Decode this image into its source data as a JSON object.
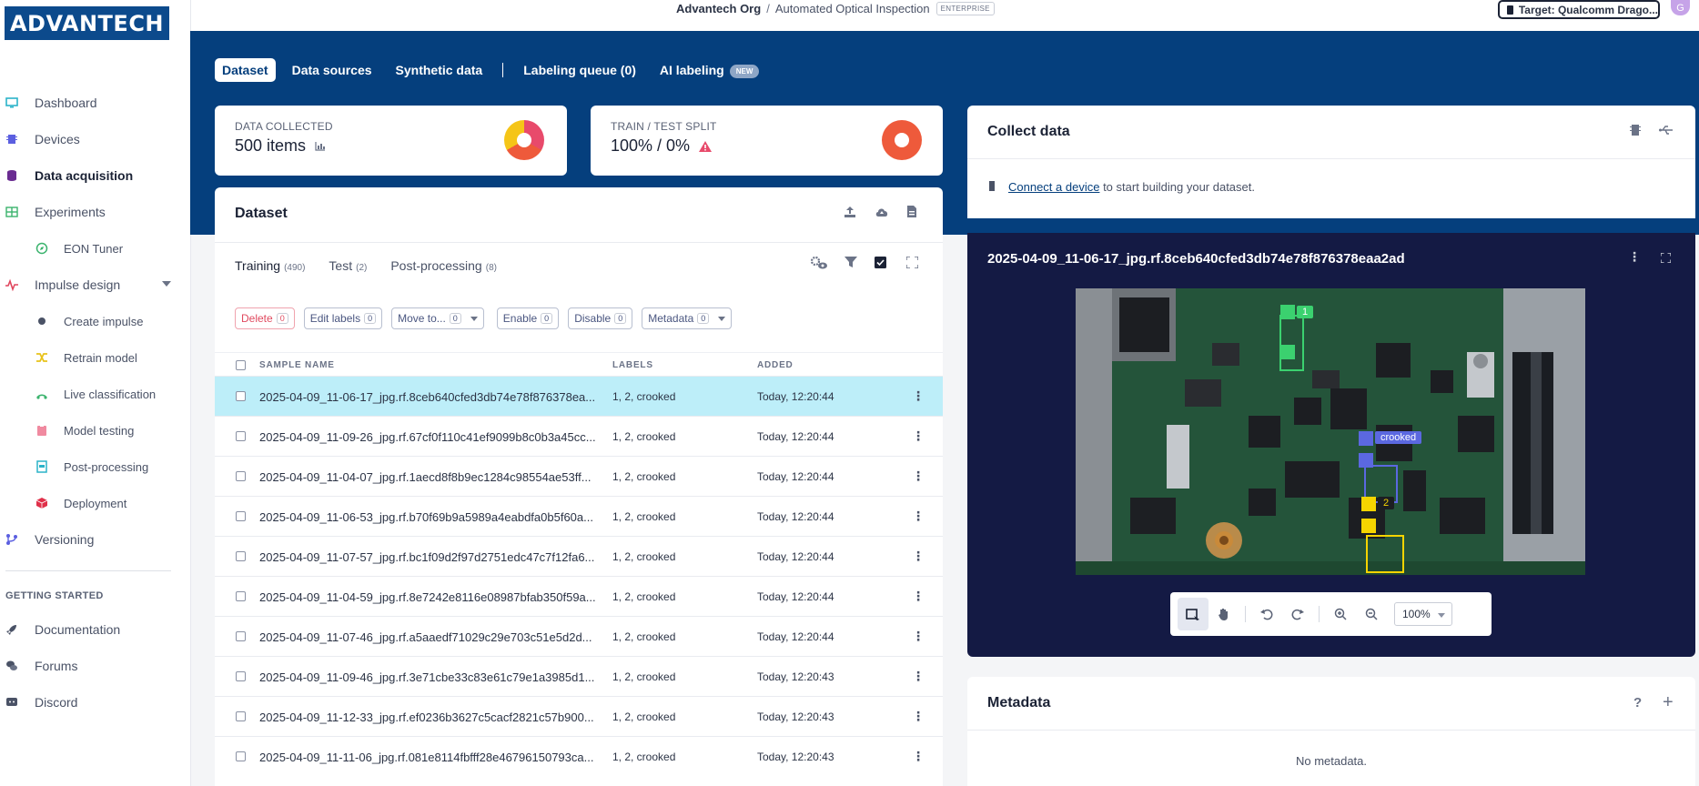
{
  "brand": {
    "logo_text": "ADVANTECH"
  },
  "sidebar": {
    "items": [
      {
        "label": "Dashboard",
        "icon": "monitor-icon",
        "color": "#2bb3c9"
      },
      {
        "label": "Devices",
        "icon": "chip-icon",
        "color": "#5b5fe0"
      },
      {
        "label": "Data acquisition",
        "icon": "database-icon",
        "color": "#6a2c91"
      },
      {
        "label": "Experiments",
        "icon": "table-icon",
        "color": "#3bb36d"
      },
      {
        "label": "EON Tuner",
        "icon": "compass-icon",
        "color": "#3bb36d"
      },
      {
        "label": "Impulse design",
        "icon": "pulse-icon",
        "color": "#e0475e"
      },
      {
        "label": "Create impulse",
        "icon": "dot-icon",
        "color": "#4a5266"
      },
      {
        "label": "Retrain model",
        "icon": "shuffle-icon",
        "color": "#e8c21a"
      },
      {
        "label": "Live classification",
        "icon": "signal-icon",
        "color": "#3bb36d"
      },
      {
        "label": "Model testing",
        "icon": "clipboard-icon",
        "color": "#f08aa0"
      },
      {
        "label": "Post-processing",
        "icon": "doc-icon",
        "color": "#2bb3c9"
      },
      {
        "label": "Deployment",
        "icon": "cube-icon",
        "color": "#e0304a"
      },
      {
        "label": "Versioning",
        "icon": "branch-icon",
        "color": "#5b5fe0"
      }
    ],
    "getting_started_heading": "GETTING STARTED",
    "getting_started": [
      {
        "label": "Documentation",
        "icon": "rocket-icon"
      },
      {
        "label": "Forums",
        "icon": "chat-icon"
      },
      {
        "label": "Discord",
        "icon": "discord-icon"
      }
    ]
  },
  "topbar": {
    "org": "Advantech Org",
    "separator": "/",
    "project": "Automated Optical Inspection",
    "badge": "ENTERPRISE",
    "target_label": "Target: Qualcomm Drago...",
    "avatar_initial": "G"
  },
  "tabs": {
    "dataset": "Dataset",
    "data_sources": "Data sources",
    "synthetic": "Synthetic data",
    "labeling_queue": "Labeling queue (0)",
    "ai_labeling": "AI labeling",
    "new_badge": "NEW"
  },
  "stats": {
    "collected_label": "DATA COLLECTED",
    "collected_value": "500 items",
    "split_label": "TRAIN / TEST SPLIT",
    "split_value": "100% / 0%"
  },
  "collect": {
    "title": "Collect data",
    "link": "Connect a device",
    "rest": " to start building your dataset."
  },
  "dataset": {
    "title": "Dataset",
    "subtabs": [
      {
        "label": "Training",
        "count": "(490)"
      },
      {
        "label": "Test",
        "count": "(2)"
      },
      {
        "label": "Post-processing",
        "count": "(8)"
      }
    ],
    "actions": {
      "delete": "Delete",
      "delete_n": "0",
      "edit": "Edit labels",
      "edit_n": "0",
      "move": "Move to...",
      "move_n": "0",
      "enable": "Enable",
      "enable_n": "0",
      "disable": "Disable",
      "disable_n": "0",
      "metadata": "Metadata",
      "metadata_n": "0"
    },
    "columns": {
      "name": "SAMPLE NAME",
      "labels": "LABELS",
      "added": "ADDED"
    },
    "rows": [
      {
        "name": "2025-04-09_11-06-17_jpg.rf.8ceb640cfed3db74e78f876378ea...",
        "labels": "1, 2, crooked",
        "added": "Today, 12:20:44"
      },
      {
        "name": "2025-04-09_11-09-26_jpg.rf.67cf0f110c41ef9099b8c0b3a45cc...",
        "labels": "1, 2, crooked",
        "added": "Today, 12:20:44"
      },
      {
        "name": "2025-04-09_11-04-07_jpg.rf.1aecd8f8b9ec1284c98554ae53ff...",
        "labels": "1, 2, crooked",
        "added": "Today, 12:20:44"
      },
      {
        "name": "2025-04-09_11-06-53_jpg.rf.b70f69b9a5989a4eabdfa0b5f60a...",
        "labels": "1, 2, crooked",
        "added": "Today, 12:20:44"
      },
      {
        "name": "2025-04-09_11-07-57_jpg.rf.bc1f09d2f97d2751edc47c7f12fa6...",
        "labels": "1, 2, crooked",
        "added": "Today, 12:20:44"
      },
      {
        "name": "2025-04-09_11-04-59_jpg.rf.8e7242e8116e08987bfab350f59a...",
        "labels": "1, 2, crooked",
        "added": "Today, 12:20:44"
      },
      {
        "name": "2025-04-09_11-07-46_jpg.rf.a5aaedf71029c29e703c51e5d2d...",
        "labels": "1, 2, crooked",
        "added": "Today, 12:20:44"
      },
      {
        "name": "2025-04-09_11-09-46_jpg.rf.3e71cbe33c83e61c79e1a3985d1...",
        "labels": "1, 2, crooked",
        "added": "Today, 12:20:43"
      },
      {
        "name": "2025-04-09_11-12-33_jpg.rf.ef0236b3627c5cacf2821c57b900...",
        "labels": "1, 2, crooked",
        "added": "Today, 12:20:43"
      },
      {
        "name": "2025-04-09_11-11-06_jpg.rf.081e8114fbfff28e46796150793ca...",
        "labels": "1, 2, crooked",
        "added": "Today, 12:20:43"
      }
    ]
  },
  "viewer": {
    "title": "2025-04-09_11-06-17_jpg.rf.8ceb640cfed3db74e78f876378eaa2ad",
    "box_labels": {
      "a": "1",
      "b": "crooked",
      "c": "2"
    },
    "zoom": "100%"
  },
  "metadata": {
    "title": "Metadata",
    "empty": "No metadata."
  },
  "colors": {
    "band": "#053f7d",
    "selected_row": "#bdeef9",
    "viewer_bg": "#141a44",
    "pie_a": "#f5c518",
    "pie_b": "#ee5a3b",
    "pie_c": "#e84a6b"
  }
}
